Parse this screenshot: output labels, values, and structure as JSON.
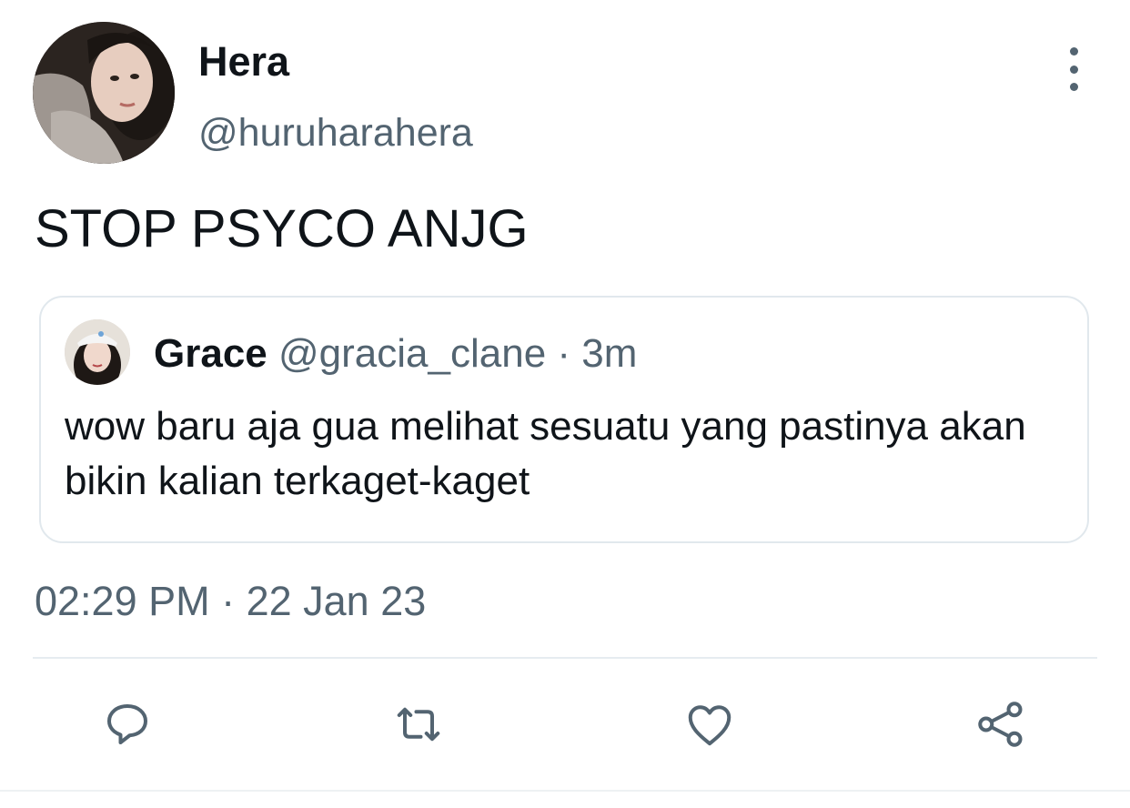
{
  "tweet": {
    "author": {
      "name": "Hera",
      "handle": "@huruharahera"
    },
    "text": "STOP PSYCO ANJG",
    "quoted": {
      "name": "Grace",
      "handle": "@gracia_clane",
      "separator": "·",
      "time": "3m",
      "text": "wow baru aja gua melihat sesuatu yang pastinya akan bikin kalian terkaget-kaget"
    },
    "timestamp": "02:29 PM · 22 Jan 23"
  },
  "icons": {
    "more": "more-vertical-icon",
    "reply": "reply-icon",
    "retweet": "retweet-icon",
    "like": "heart-icon",
    "share": "share-icon"
  },
  "colors": {
    "text_primary": "#0f1419",
    "text_secondary": "#536471",
    "border": "#e1e8ed"
  }
}
